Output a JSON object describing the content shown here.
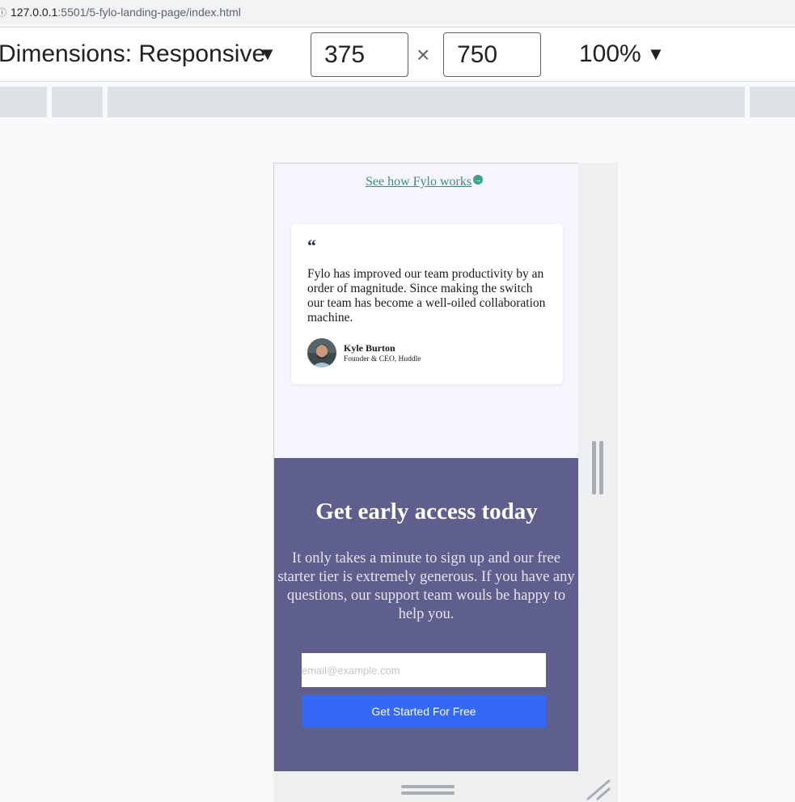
{
  "browser": {
    "url_host": "127.0.0.1",
    "url_path": ":5501/5-fylo-landing-page/index.html"
  },
  "devtools": {
    "dimensions_label": "Dimensions: Responsive",
    "width_value": "375",
    "times_symbol": "×",
    "height_value": "750",
    "zoom_label": "100%"
  },
  "page": {
    "see_how_link": "See how Fylo works",
    "testimonial": {
      "quote_mark": "“",
      "text": "Fylo has improved our team productivity by an order of magnitude. Since making the switch our team has become a well-oiled collaboration machine.",
      "name": "Kyle Burton",
      "role": "Founder & CEO, Huddle"
    },
    "cta": {
      "title": "Get early access today",
      "body": "It only takes a minute to sign up and our free starter tier is extremely generous. If you have any questions, our support team wouls be happy to help you.",
      "email_placeholder": "email@example.com",
      "button_label": "Get Started For Free"
    }
  },
  "colors": {
    "cta_background": "#5f5f8d",
    "button": "#3468f5",
    "link": "#3e8a80",
    "page_background": "#f5f6fd"
  }
}
